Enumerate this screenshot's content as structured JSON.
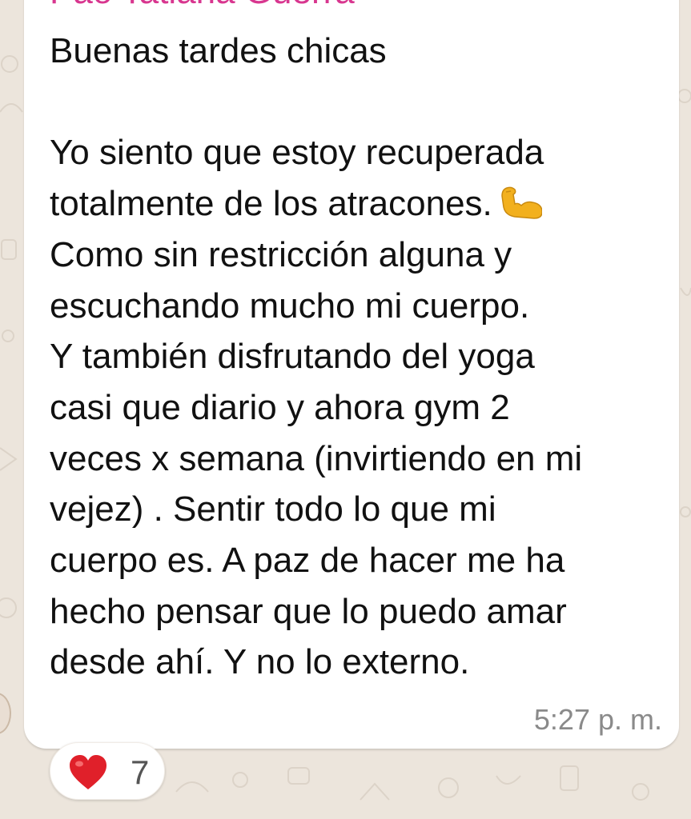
{
  "chat": {
    "sender_name": "Pao Tatiana Guerra",
    "message_lines": [
      "Buenas tardes chicas",
      "",
      "Yo siento que estoy recuperada",
      "totalmente de los atracones.",
      "Como sin restricción alguna y",
      "escuchando mucho mi cuerpo.",
      "Y también disfrutando del yoga",
      "casi que diario y ahora gym 2",
      "veces x semana (invirtiendo en mi",
      "vejez) . Sentir todo lo que mi",
      "cuerpo es. A paz de hacer me ha",
      "hecho pensar que lo puedo amar",
      "desde ahí. Y no lo externo."
    ],
    "inline_emoji": "flexed-biceps-emoji",
    "timestamp": "5:27 p. m.",
    "reaction": {
      "emoji": "red-heart-emoji",
      "count": "7"
    }
  },
  "colors": {
    "sender_name": "#d8368f",
    "wallpaper": "#ece5dc",
    "bubble": "#ffffff",
    "heart": "#e0202a",
    "arm": "#f2b01e"
  }
}
